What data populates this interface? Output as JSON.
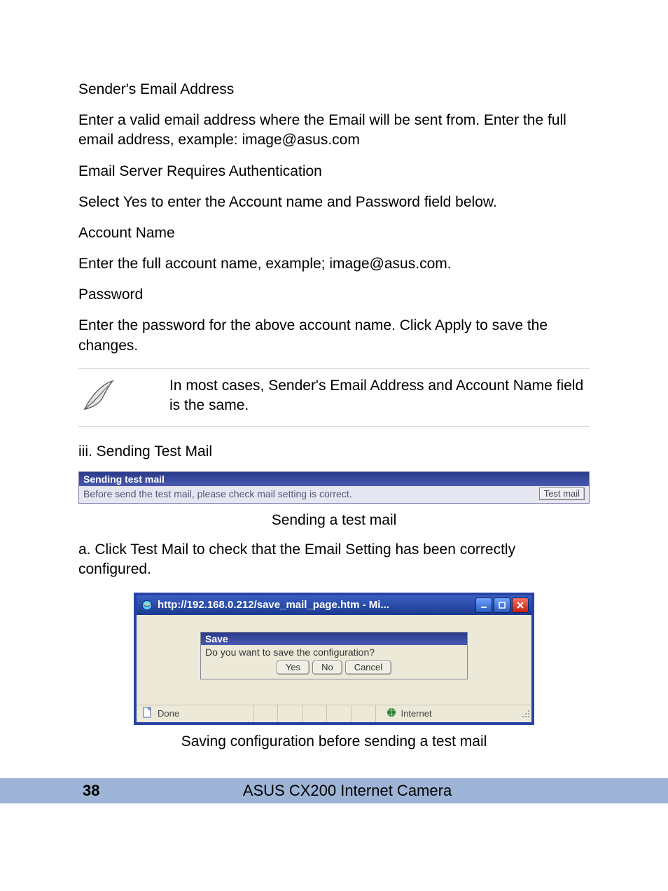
{
  "doc": {
    "h_sender": "Sender's Email Address",
    "p_sender": "Enter a valid email address where the Email will be sent from.  Enter the full email address, example: image@asus.com",
    "h_auth": "Email Server Requires Authentication",
    "p_auth": "Select Yes to enter the Account name and Password field below.",
    "h_account": "Account Name",
    "p_account": "Enter the full account name, example; image@asus.com.",
    "h_password": "Password",
    "p_password": "Enter the password for the above account name.  Click Apply to save the changes.",
    "note": "In most cases, Sender's Email Address and Account Name field is the same.",
    "section_iii": "iii. Sending Test Mail",
    "caption1": "Sending a test mail",
    "p_step_a": "a. Click Test Mail to check that the Email Setting has been correctly configured.",
    "caption2": "Saving configuration before sending a test mail"
  },
  "stm": {
    "title": "Sending test mail",
    "body": "Before send the test mail, please check mail setting is correct.",
    "button": "Test mail"
  },
  "dialog": {
    "title": "http://192.168.0.212/save_mail_page.htm - Mi...",
    "save_header": "Save",
    "save_prompt": "Do you want to save the configuration?",
    "btn_yes": "Yes",
    "btn_no": "No",
    "btn_cancel": "Cancel",
    "status_done": "Done",
    "status_zone": "Internet"
  },
  "footer": {
    "page": "38",
    "title": "ASUS CX200 Internet Camera"
  }
}
